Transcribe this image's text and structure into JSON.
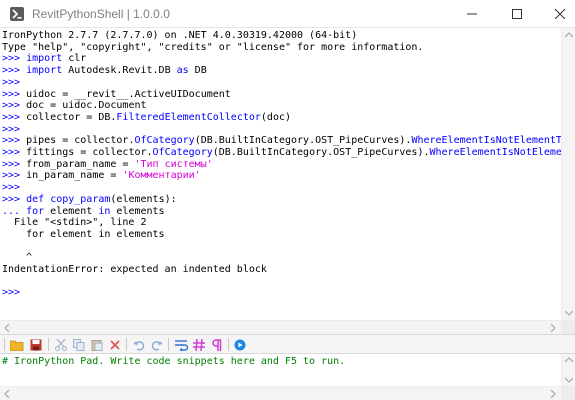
{
  "window": {
    "title": "RevitPythonShell | 1.0.0.0"
  },
  "console": {
    "lines": [
      {
        "prompt": "",
        "segments": [
          {
            "t": "IronPython 2.7.7 (2.7.7.0) on .NET 4.0.30319.42000 (64-bit)",
            "c": "n"
          }
        ]
      },
      {
        "prompt": "",
        "segments": [
          {
            "t": "Type \"help\", \"copyright\", \"credits\" or \"license\" for more information.",
            "c": "n"
          }
        ]
      },
      {
        "prompt": ">>> ",
        "segments": [
          {
            "t": "import",
            "c": "kw"
          },
          {
            "t": " clr",
            "c": "n"
          }
        ]
      },
      {
        "prompt": ">>> ",
        "segments": [
          {
            "t": "import",
            "c": "kw"
          },
          {
            "t": " Autodesk.Revit.DB ",
            "c": "n"
          },
          {
            "t": "as",
            "c": "kw"
          },
          {
            "t": " DB",
            "c": "n"
          }
        ]
      },
      {
        "prompt": ">>>",
        "segments": []
      },
      {
        "prompt": ">>> ",
        "segments": [
          {
            "t": "uidoc = __revit__.ActiveUIDocument",
            "c": "n"
          }
        ]
      },
      {
        "prompt": ">>> ",
        "segments": [
          {
            "t": "doc = uidoc.Document",
            "c": "n"
          }
        ]
      },
      {
        "prompt": ">>> ",
        "segments": [
          {
            "t": "collector = DB.",
            "c": "n"
          },
          {
            "t": "FilteredElementCollector",
            "c": "fn"
          },
          {
            "t": "(doc)",
            "c": "n"
          }
        ]
      },
      {
        "prompt": ">>>",
        "segments": []
      },
      {
        "prompt": ">>> ",
        "segments": [
          {
            "t": "pipes = collector.",
            "c": "n"
          },
          {
            "t": "OfCategory",
            "c": "fn"
          },
          {
            "t": "(DB.BuiltInCategory.OST_PipeCurves).",
            "c": "n"
          },
          {
            "t": "WhereElementIsNotElementType",
            "c": "fn"
          },
          {
            "t": "()",
            "c": "n"
          }
        ]
      },
      {
        "prompt": ">>> ",
        "segments": [
          {
            "t": "fittings = collector.",
            "c": "n"
          },
          {
            "t": "OfCategory",
            "c": "fn"
          },
          {
            "t": "(DB.BuiltInCategory.OST_PipeCurves).",
            "c": "n"
          },
          {
            "t": "WhereElementIsNotElementType",
            "c": "fn"
          },
          {
            "t": "()",
            "c": "n"
          }
        ]
      },
      {
        "prompt": ">>> ",
        "segments": [
          {
            "t": "from_param_name = ",
            "c": "n"
          },
          {
            "t": "'Тип системы'",
            "c": "str"
          }
        ]
      },
      {
        "prompt": ">>> ",
        "segments": [
          {
            "t": "in_param_name = ",
            "c": "n"
          },
          {
            "t": "'Комментарии'",
            "c": "str"
          }
        ]
      },
      {
        "prompt": ">>>",
        "segments": []
      },
      {
        "prompt": ">>> ",
        "segments": [
          {
            "t": "def",
            "c": "kw"
          },
          {
            "t": " ",
            "c": "n"
          },
          {
            "t": "copy_param",
            "c": "fn"
          },
          {
            "t": "(elements):",
            "c": "n"
          }
        ]
      },
      {
        "prompt": "... ",
        "segments": [
          {
            "t": "for",
            "c": "kw"
          },
          {
            "t": " element ",
            "c": "n"
          },
          {
            "t": "in",
            "c": "kw"
          },
          {
            "t": " elements",
            "c": "n"
          }
        ]
      },
      {
        "prompt": "",
        "segments": [
          {
            "t": "  File \"<stdin>\", line 2",
            "c": "n"
          }
        ]
      },
      {
        "prompt": "",
        "segments": [
          {
            "t": "    for element in elements",
            "c": "n"
          }
        ]
      },
      {
        "prompt": "",
        "segments": []
      },
      {
        "prompt": "",
        "segments": [
          {
            "t": "    ^",
            "c": "n"
          }
        ]
      },
      {
        "prompt": "",
        "segments": [
          {
            "t": "IndentationError: expected an indented block",
            "c": "n"
          }
        ]
      },
      {
        "prompt": "",
        "segments": []
      },
      {
        "prompt": ">>>",
        "segments": []
      }
    ]
  },
  "toolbar": {
    "buttons": [
      {
        "name": "open-icon",
        "color": "#e8a317"
      },
      {
        "name": "save-icon",
        "color": "#c0392b"
      },
      {
        "name": "cut-icon",
        "color": "#9eb3cc"
      },
      {
        "name": "copy-icon",
        "color": "#9eb3cc"
      },
      {
        "name": "paste-icon",
        "color": "#9eb3cc"
      },
      {
        "name": "delete-icon",
        "color": "#e05555"
      },
      {
        "name": "undo-icon",
        "color": "#8aa8d6"
      },
      {
        "name": "redo-icon",
        "color": "#8aa8d6"
      },
      {
        "name": "word-wrap-icon",
        "color": "#2b6fd6"
      },
      {
        "name": "hash-icon",
        "color": "#d23bd2"
      },
      {
        "name": "pilcrow-icon",
        "color": "#d23bd2"
      },
      {
        "name": "run-icon",
        "color": "#2187e7"
      }
    ]
  },
  "pad": {
    "text": "# IronPython Pad. Write code snippets here and F5 to run."
  },
  "colors": {
    "keyword": "#0000ff",
    "string": "#d600d6",
    "comment": "#008000",
    "prompt": "#0000ff"
  }
}
